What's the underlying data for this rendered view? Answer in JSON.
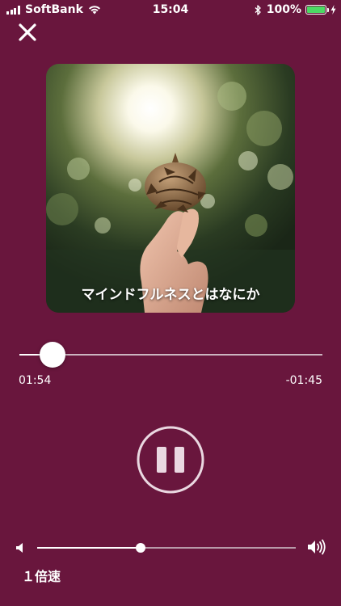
{
  "status_bar": {
    "carrier": "SoftBank",
    "time": "15:04",
    "battery": "100%"
  },
  "player": {
    "close_icon": "close-icon",
    "track_title": "マインドフルネスとはなにか",
    "elapsed": "01:54",
    "remaining": "-01:45",
    "progress_fraction": 0.11,
    "volume_fraction": 0.4,
    "speed_label": "１倍速",
    "state": "playing"
  },
  "colors": {
    "background": "#69163d",
    "battery_fill": "#4cd964",
    "controls": "#ffffff"
  }
}
